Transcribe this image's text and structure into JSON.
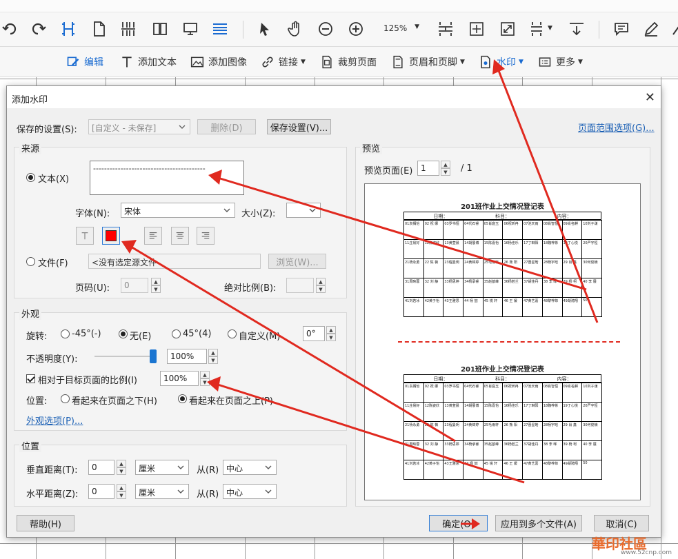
{
  "toolbar": {
    "zoom": "125%"
  },
  "edit_toolbar": {
    "edit": "编辑",
    "add_text": "添加文本",
    "add_image": "添加图像",
    "link": "链接",
    "crop": "裁剪页面",
    "header_footer": "页眉和页脚",
    "watermark": "水印",
    "more": "更多"
  },
  "dialog": {
    "title": "添加水印",
    "saved_settings_label": "保存的设置(S):",
    "saved_settings_value": "[自定义 - 未保存]",
    "delete_btn": "删除(D)",
    "save_settings_btn": "保存设置(V)...",
    "page_range_link": "页面范围选项(G)...",
    "source": {
      "title": "来源",
      "text_option": "文本(X)",
      "text_value": "-----------------------------------------",
      "font_label": "字体(N):",
      "font_value": "宋体",
      "size_label": "大小(Z):",
      "size_value": "",
      "text_color": "#ff0000",
      "file_option": "文件(F)",
      "file_value": "<没有选定源文件",
      "browse_btn": "浏览(W)...",
      "page_num_label": "页码(U):",
      "page_num_value": "0",
      "abs_scale_label": "绝对比例(B):",
      "abs_scale_value": ""
    },
    "appearance": {
      "title": "外观",
      "rotation_label": "旋转:",
      "rot_neg45": "-45°(-)",
      "rot_none": "无(E)",
      "rot_pos45": "45°(4)",
      "rot_custom": "自定义(M)",
      "rot_custom_value": "0°",
      "opacity_label": "不透明度(Y):",
      "opacity_value": "100%",
      "opacity_level": 1.0,
      "relative_scale_label": "相对于目标页面的比例(I)",
      "relative_scale_value": "100%",
      "position_label": "位置:",
      "behind_page": "看起来在页面之下(H)",
      "on_top_page": "看起来在页面之上(P)",
      "appearance_options_link": "外观选项(P)..."
    },
    "position": {
      "title": "位置",
      "vertical_label": "垂直距离(T):",
      "vertical_value": "0",
      "vertical_unit": "厘米",
      "from_label_v": "从(R)",
      "vertical_from": "中心",
      "horizontal_label": "水平距离(Z):",
      "horizontal_value": "0",
      "horizontal_unit": "厘米",
      "from_label_h": "从(R)",
      "horizontal_from": "中心"
    },
    "preview": {
      "title": "预览",
      "page_label": "预览页面(E)",
      "page_value": "1",
      "page_total": "/ 1",
      "sheet_title": "201班作业上交情况登记表",
      "meta": [
        "日期：",
        "科目：",
        "内容："
      ],
      "rows": [
        [
          "01袁搁怡",
          "02 祝 娜",
          "03罗书恒",
          "04代石睿",
          "05肖庭玉",
          "06祝昕冉",
          "07池天雨",
          "08肖智恒",
          "09肖名麒",
          "10刘子谦"
        ],
        [
          "11庄易好",
          "12陈姿欣",
          "13黄萱晨",
          "14胡展博",
          "15陈嘉怡",
          "16杨佳乐",
          "17丁琳阳",
          "18魏梓彬",
          "19丁心悦",
          "20严宇恒"
        ],
        [
          "21杨永勇",
          "22 陈 薇",
          "23程曼玥",
          "24黄锦婷",
          "25毛雨轩",
          "26 熊 阳",
          "27晋星皓",
          "28杨宇晗",
          "29 肖 鑫",
          "30何俊楠"
        ],
        [
          "31周映蓉",
          "32 刘 静",
          "33杨思婷",
          "34杨承睿",
          "35赵歆峰",
          "36杨若兰",
          "37胡佳丹",
          "38 李 晖",
          "39 杨 柯",
          "40 李 展"
        ],
        [
          "41刘若冰",
          "42黄子怡",
          "43王雅思",
          "44 杨 喆",
          "45 锐 轩",
          "46 王 媛",
          "47黄艺嘉",
          "48黎梓菲",
          "49胡骋翔",
          "50"
        ]
      ]
    },
    "help_btn": "帮助(H)",
    "ok_btn": "确定(O)",
    "apply_multi_btn": "应用到多个文件(A)",
    "cancel_btn": "取消(C)"
  },
  "accent_color": "#1a6bd1",
  "annotation_color": "#e0291f",
  "watermark_site": {
    "logo": "華印社區",
    "url": "www.52cnp.com"
  }
}
